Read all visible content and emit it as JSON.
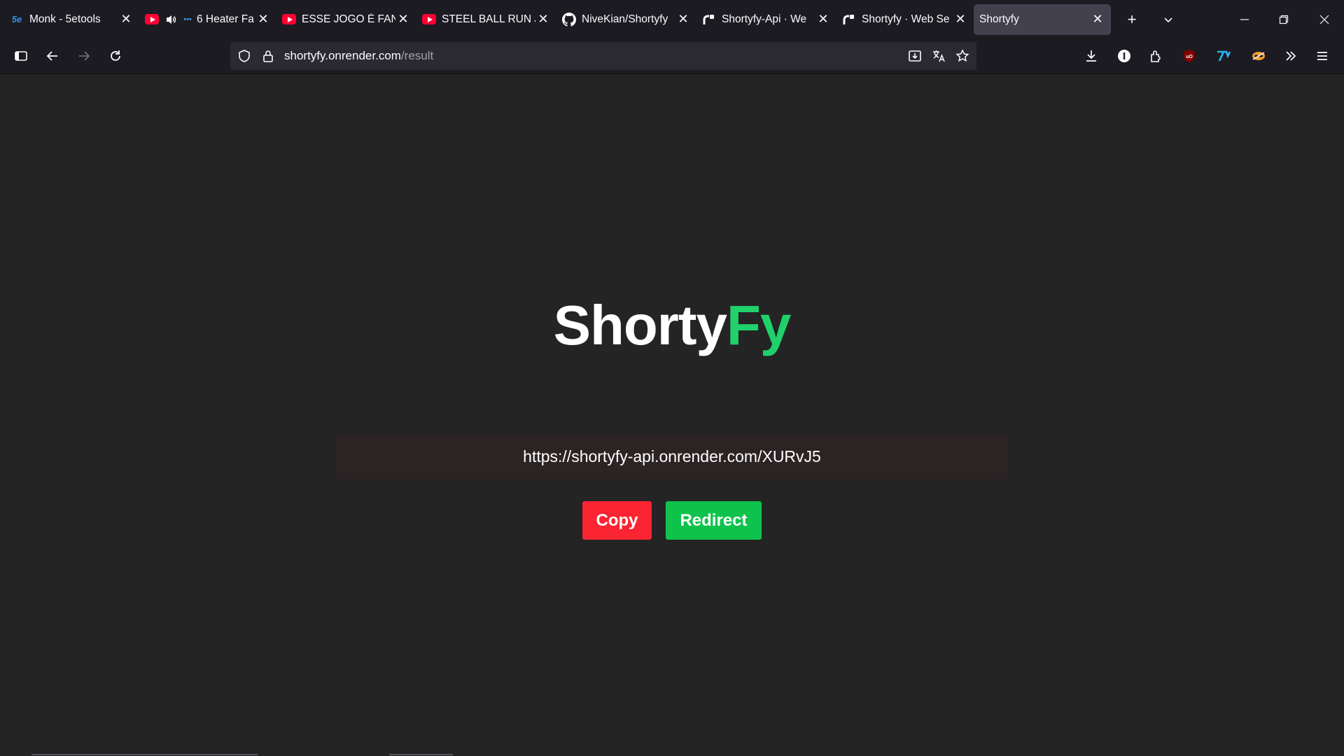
{
  "browser": {
    "tabs": [
      {
        "label": "Monk - 5etools",
        "favicon": "5etools-icon"
      },
      {
        "label": "6 Heater Fa",
        "favicon": "youtube-icon"
      },
      {
        "label": "ESSE JOGO É FANTÁ",
        "favicon": "youtube-icon"
      },
      {
        "label": "STEEL BALL RUN Jo",
        "favicon": "youtube-icon"
      },
      {
        "label": "NiveKian/Shortyfy",
        "favicon": "github-icon"
      },
      {
        "label": "Shortyfy-Api · We",
        "favicon": "render-icon"
      },
      {
        "label": "Shortyfy · Web Se",
        "favicon": "render-icon"
      },
      {
        "label": "Shortyfy",
        "favicon": "none"
      }
    ],
    "favicon_text": {
      "5etools": "5e"
    },
    "close_glyph": "✕",
    "new_tab_glyph": "+",
    "list_tabs_glyph": "⌄",
    "url": {
      "domain": "shortyfy.onrender.com",
      "path": "/result"
    }
  },
  "page": {
    "logo": {
      "main": "Shorty",
      "accent": "Fy"
    },
    "short_url": "https://shortyfy-api.onrender.com/XURvJ5",
    "copy_label": "Copy",
    "redirect_label": "Redirect"
  },
  "colors": {
    "accent_green": "#20d16b",
    "copy_red": "#fb2432",
    "redirect_green": "#0dc34b",
    "page_bg": "#242424"
  }
}
